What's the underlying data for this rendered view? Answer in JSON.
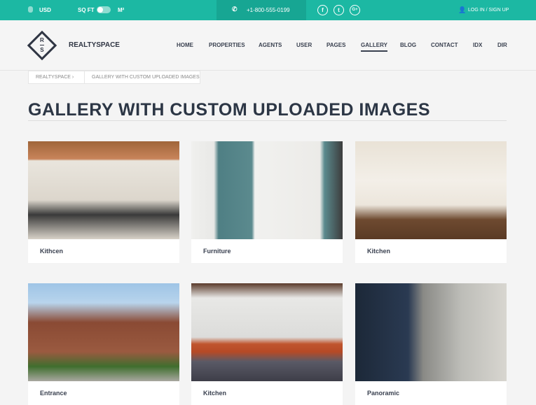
{
  "topbar": {
    "currency": "USD",
    "unit_left": "SQ FT",
    "unit_right": "M²",
    "phone": "+1-800-555-0199",
    "social": [
      "f",
      "t",
      "G+"
    ],
    "login": "LOG IN / SIGN UP"
  },
  "brand": {
    "logo_letters": [
      "R",
      "S"
    ],
    "name": "REALTYSPACE"
  },
  "nav": [
    "HOME",
    "PROPERTIES",
    "AGENTS",
    "USER",
    "PAGES",
    "GALLERY",
    "BLOG",
    "CONTACT",
    "IDX",
    "DIR"
  ],
  "nav_active": "GALLERY",
  "breadcrumb": [
    "REALTYSPACE",
    "GALLERY WITH CUSTOM UPLOADED IMAGES"
  ],
  "title": "GALLERY WITH CUSTOM UPLOADED IMAGES",
  "gallery": [
    {
      "label": "Kithcen"
    },
    {
      "label": "Furniture"
    },
    {
      "label": "Kitchen"
    },
    {
      "label": "Entrance"
    },
    {
      "label": "Kitchen"
    },
    {
      "label": "Panoramic"
    }
  ],
  "colors": {
    "accent": "#1cb8a3",
    "accent_dark": "#17a693"
  }
}
